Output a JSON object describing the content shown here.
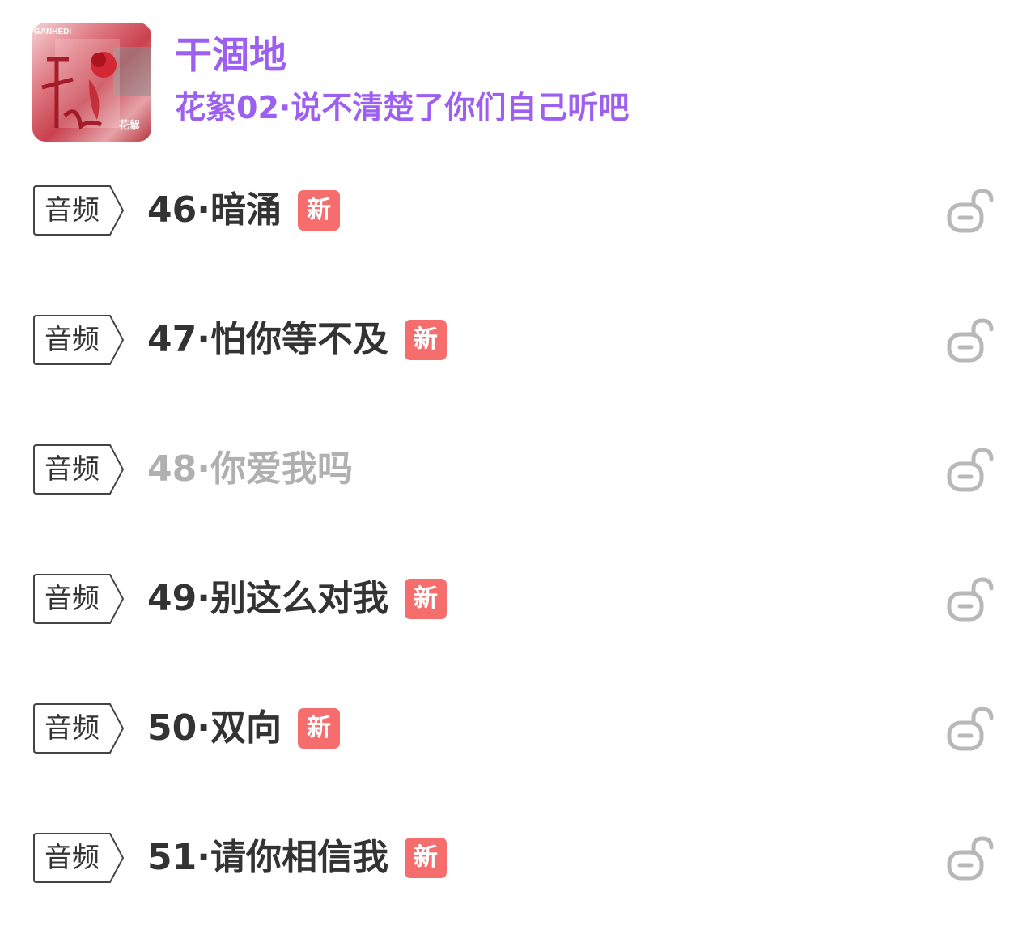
{
  "album": {
    "title": "干涸地",
    "subtitle": "花絮02·说不清楚了你们自己听吧",
    "cover_tag": "GANHEDI",
    "cover_mark": "花絮",
    "accent_color": "#9c5ff0"
  },
  "tag_label": "音频",
  "badge_label": "新",
  "colors": {
    "badge": "#f56d6d",
    "title": "#333333",
    "title_dim": "#b0b0b0",
    "lock": "#b8b8b8"
  },
  "episodes": [
    {
      "tag": "音频",
      "title": "46·暗涌",
      "badge": "新",
      "dim": false,
      "icon": "unlock-icon"
    },
    {
      "tag": "音频",
      "title": "47·怕你等不及",
      "badge": "新",
      "dim": false,
      "icon": "unlock-icon"
    },
    {
      "tag": "音频",
      "title": "48·你爱我吗",
      "badge": "",
      "dim": true,
      "icon": "unlock-icon"
    },
    {
      "tag": "音频",
      "title": "49·别这么对我",
      "badge": "新",
      "dim": false,
      "icon": "unlock-icon"
    },
    {
      "tag": "音频",
      "title": "50·双向",
      "badge": "新",
      "dim": false,
      "icon": "unlock-icon"
    },
    {
      "tag": "音频",
      "title": "51·请你相信我",
      "badge": "新",
      "dim": false,
      "icon": "unlock-icon"
    }
  ]
}
